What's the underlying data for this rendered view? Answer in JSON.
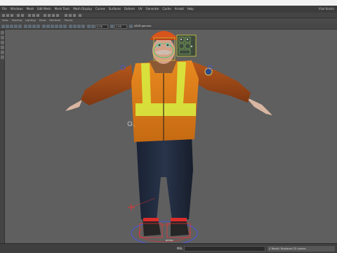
{
  "menubar": {
    "items": [
      "File",
      "Windows",
      "Mesh",
      "Edit Mesh",
      "Mesh Tools",
      "Mesh Display",
      "Curves",
      "Surfaces",
      "Deform",
      "UV",
      "Generate",
      "Cache",
      "Arnold",
      "Help"
    ],
    "right_text": "Vlad Kostin"
  },
  "viewmenu": {
    "items": [
      "View",
      "Shading",
      "Lighting",
      "Show",
      "Renderer",
      "Panels"
    ]
  },
  "panel_toolbar": {
    "field_1": "0.00",
    "field_2": "1.00",
    "colorspace": "sRGB gamma"
  },
  "viewport": {
    "camera_label": "persp",
    "background_color": "#5f5f5f"
  },
  "commandline": {
    "language": "MEL",
    "result": "// Result: Replaced 32 names"
  },
  "colors": {
    "selection_red": "#ff2e2e",
    "manipulator_blue": "#4a56e0",
    "vest_orange": "#e8891f",
    "reflective_yellow": "#d7ea3f"
  }
}
